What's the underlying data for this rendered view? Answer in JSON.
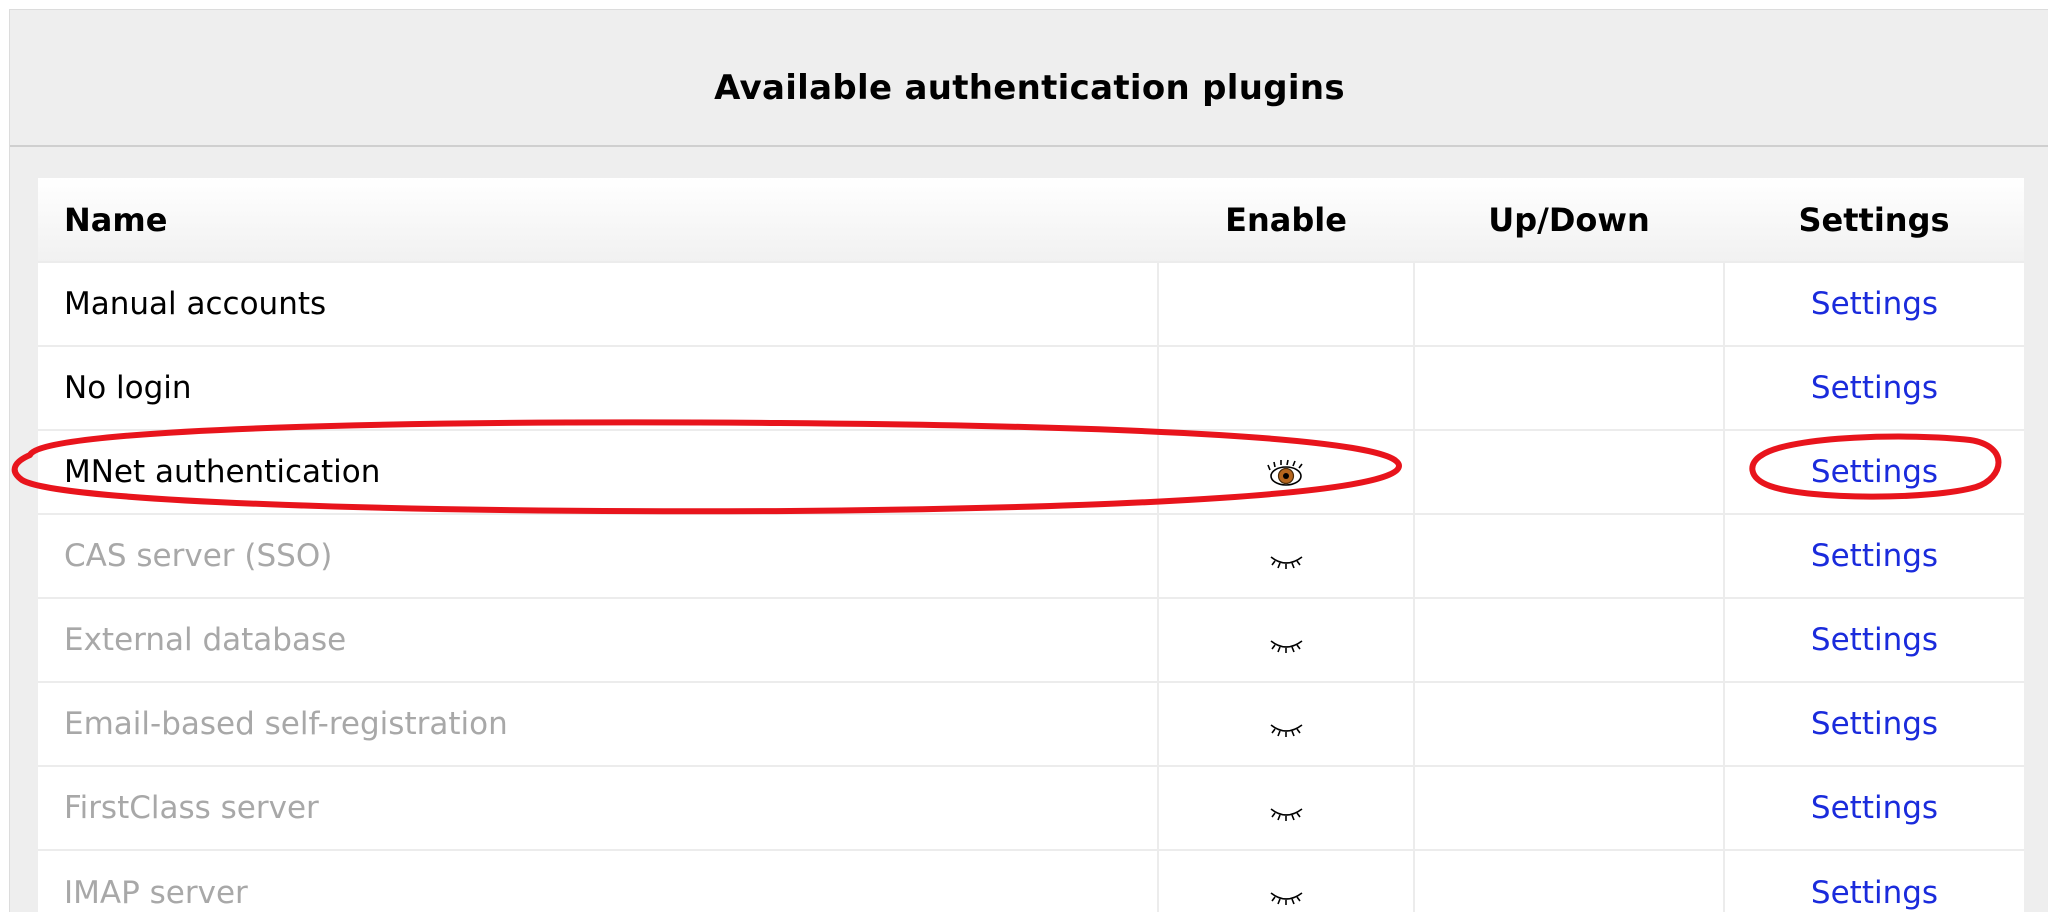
{
  "panel": {
    "title": "Available authentication plugins"
  },
  "table": {
    "columns": {
      "name": "Name",
      "enable": "Enable",
      "updown": "Up/Down",
      "settings": "Settings"
    },
    "rows": [
      {
        "name": "Manual accounts",
        "enabled_icon": "none",
        "settings": "Settings",
        "state": "active"
      },
      {
        "name": "No login",
        "enabled_icon": "none",
        "settings": "Settings",
        "state": "active"
      },
      {
        "name": "MNet authentication",
        "enabled_icon": "eye-open-icon",
        "settings": "Settings",
        "state": "active"
      },
      {
        "name": "CAS server (SSO)",
        "enabled_icon": "eye-closed-icon",
        "settings": "Settings",
        "state": "disabled"
      },
      {
        "name": "External database",
        "enabled_icon": "eye-closed-icon",
        "settings": "Settings",
        "state": "disabled"
      },
      {
        "name": "Email-based self-registration",
        "enabled_icon": "eye-closed-icon",
        "settings": "Settings",
        "state": "disabled"
      },
      {
        "name": "FirstClass server",
        "enabled_icon": "eye-closed-icon",
        "settings": "Settings",
        "state": "disabled"
      },
      {
        "name": "IMAP server",
        "enabled_icon": "eye-closed-icon",
        "settings": "Settings",
        "state": "disabled"
      }
    ]
  },
  "colors": {
    "link": "#1a2bdc",
    "disabled_text": "#a8a8a8",
    "annotation": "#e8141c"
  }
}
